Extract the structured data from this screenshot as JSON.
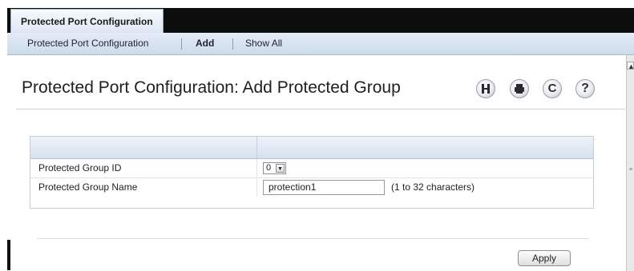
{
  "top_tab": {
    "label": "Protected Port Configuration"
  },
  "subnav": {
    "items": [
      {
        "label": "Protected Port Configuration"
      },
      {
        "label": "Add"
      },
      {
        "label": "Show All"
      }
    ]
  },
  "page": {
    "title": "Protected Port Configuration: Add Protected Group"
  },
  "toolbar": {
    "icons": [
      "save-icon",
      "print-icon",
      "refresh-icon",
      "help-icon"
    ],
    "refresh_glyph": "C",
    "help_glyph": "?"
  },
  "form": {
    "rows": [
      {
        "label": "Protected Group ID",
        "value": "0"
      },
      {
        "label": "Protected Group Name",
        "value": "protection1",
        "hint": "(1 to 32 characters)"
      }
    ]
  },
  "actions": {
    "apply_label": "Apply"
  },
  "colors": {
    "top_bar": "#0d0d0d",
    "subnav_bg": "#dce6f2",
    "panel_header": "#e3eaf4"
  }
}
